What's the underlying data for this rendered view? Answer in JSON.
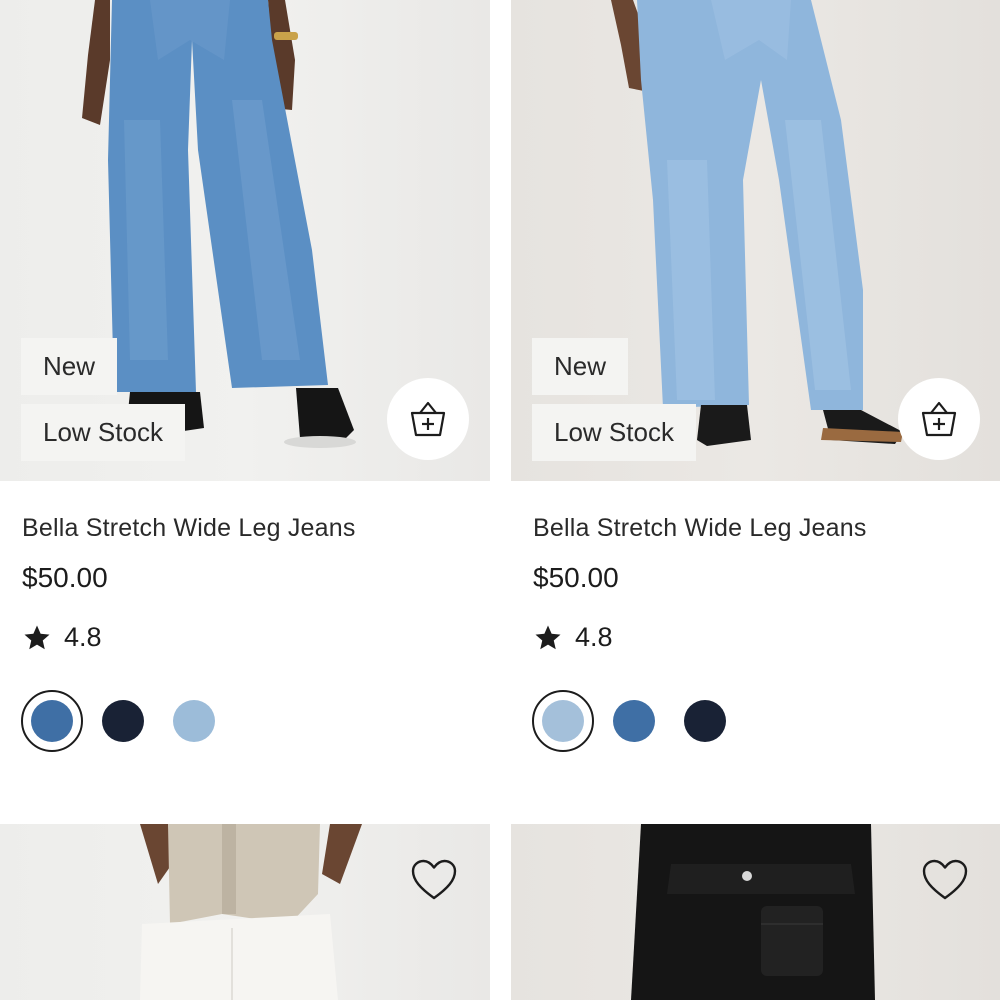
{
  "products": [
    {
      "badges": [
        "New",
        "Low Stock"
      ],
      "name": "Bella Stretch Wide Leg Jeans",
      "price": "$50.00",
      "rating": "4.8",
      "swatches": [
        {
          "color": "#3f6fa5",
          "selected": true
        },
        {
          "color": "#192235",
          "selected": false
        },
        {
          "color": "#9cbcd9",
          "selected": false
        }
      ]
    },
    {
      "badges": [
        "New",
        "Low Stock"
      ],
      "name": "Bella Stretch Wide Leg Jeans",
      "price": "$50.00",
      "rating": "4.8",
      "swatches": [
        {
          "color": "#a4c0da",
          "selected": true
        },
        {
          "color": "#3f6fa5",
          "selected": false
        },
        {
          "color": "#192235",
          "selected": false
        }
      ]
    },
    {},
    {}
  ],
  "icons": {
    "add_to_bag": "shopping-basket-plus-icon",
    "wishlist": "heart-outline-icon",
    "rating": "star-icon"
  }
}
